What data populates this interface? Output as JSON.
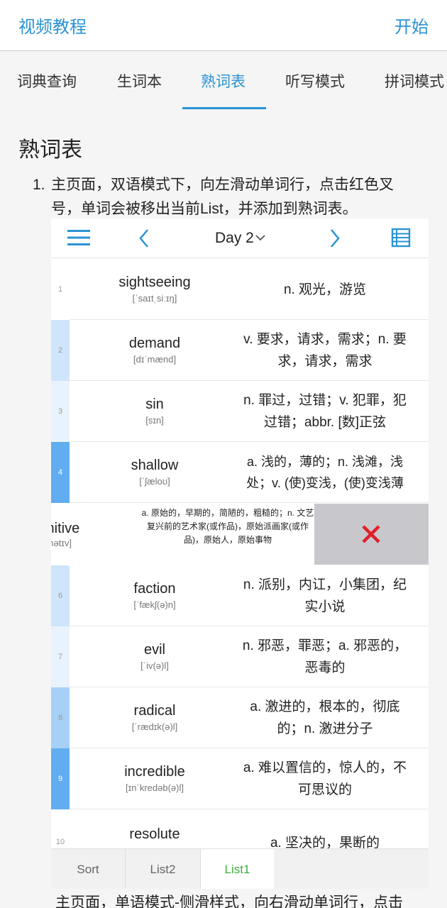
{
  "header": {
    "left_label": "视频教程",
    "right_label": "开始"
  },
  "tabs": [
    "词典查询",
    "生词本",
    "熟词表",
    "听写模式",
    "拼词模式"
  ],
  "active_tab": "熟词表",
  "section_title": "熟词表",
  "instruction": {
    "number": "1.",
    "text": "主页面，双语模式下，向左滑动单词行，点击红色叉号，单词会被移出当前List，并添加到熟词表。"
  },
  "phone": {
    "title": "Day 2",
    "colors": {
      "accent": "#2a93d5",
      "delete_mark": "#e0202a",
      "active_list": "#3cae3c"
    },
    "icons": [
      "menu-icon",
      "chevron-left-icon",
      "chevron-down-icon",
      "chevron-right-icon",
      "list-icon",
      "close-icon"
    ],
    "words": [
      {
        "index": "1",
        "word": "sightseeing",
        "phonetic": "[ˈsaɪtˌsiːɪŋ]",
        "definition": "n. 观光，游览"
      },
      {
        "index": "2",
        "word": "demand",
        "phonetic": "[dɪˈmænd]",
        "definition": "v. 要求，请求，需求；n. 要求，请求，需求"
      },
      {
        "index": "3",
        "word": "sin",
        "phonetic": "[sɪn]",
        "definition": "n. 罪过，过错；v. 犯罪，犯过错；abbr. [数]正弦"
      },
      {
        "index": "4",
        "word": "shallow",
        "phonetic": "[ˈʃæloʊ]",
        "definition": "a. 浅的，薄的；n. 浅滩，浅处；v. (使)变浅，(使)变浅薄"
      },
      {
        "index": "6",
        "word": "faction",
        "phonetic": "[ˈfækʃ(ə)n]",
        "definition": "n. 派别，内讧，小集团，纪实小说"
      },
      {
        "index": "7",
        "word": "evil",
        "phonetic": "[ˈiv(ə)l]",
        "definition": "n. 邪恶，罪恶；a. 邪恶的，恶毒的"
      },
      {
        "index": "8",
        "word": "radical",
        "phonetic": "[ˈrædɪk(ə)l]",
        "definition": "a. 激进的，根本的，彻底的；n. 激进分子"
      },
      {
        "index": "9",
        "word": "incredible",
        "phonetic": "[ɪnˈkredəb(ə)l]",
        "definition": "a. 难以置信的，惊人的，不可思议的"
      },
      {
        "index": "10",
        "word": "resolute",
        "phonetic": "",
        "definition": "a. 坚决的，果断的"
      }
    ],
    "swiped_row": {
      "word_fragment": "mitive",
      "phonetic_fragment": "ɪmətɪv]",
      "definition": "a. 原始的，早期的，简陋的，粗糙的；n. 文艺复兴前的艺术家(或作品)，原始派画家(或作品)，原始人，原始事物"
    },
    "bottom_tabs": [
      "Sort",
      "List2",
      "List1"
    ],
    "active_bottom_tab": "List1"
  },
  "footer_text": "主页面，单语模式-侧滑样式，向右滑动单词行，点击"
}
